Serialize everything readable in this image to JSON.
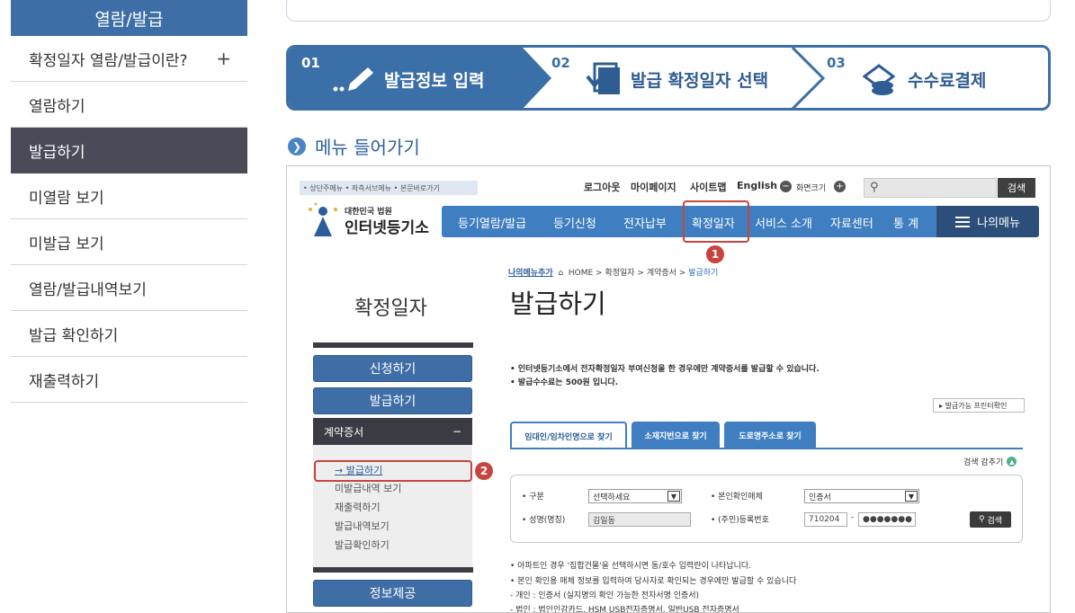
{
  "left_nav": {
    "title": "열람/발급",
    "items": [
      {
        "label": "확정일자 열람/발급이란?",
        "toggle": "+"
      },
      {
        "label": "열람하기"
      },
      {
        "label": "발급하기"
      },
      {
        "label": "미열람 보기"
      },
      {
        "label": "미발급 보기"
      },
      {
        "label": "열람/발급내역보기"
      },
      {
        "label": "발급 확인하기"
      },
      {
        "label": "재출력하기"
      }
    ]
  },
  "steps": [
    {
      "num": "01",
      "label": "발급정보 입력",
      "icon": "pencil-icon"
    },
    {
      "num": "02",
      "label": "발급 확정일자 선택",
      "icon": "document-check-icon"
    },
    {
      "num": "03",
      "label": "수수료결제",
      "icon": "coins-icon"
    }
  ],
  "section_title": "메뉴 들어가기",
  "screenshot": {
    "skip_links": "• 상단주메뉴 • 좌측서브메뉴 • 본문바로가기",
    "util": {
      "logout": "로그아웃",
      "mypage": "마이페이지",
      "sitemap": "사이트맵",
      "english": "English",
      "zoom": "화면크기",
      "minus": "−",
      "plus": "+"
    },
    "search_button": "검색",
    "logo": {
      "sub": "대한민국 법원",
      "main": "인터넷등기소"
    },
    "gnb": [
      "등기열람/발급",
      "등기신청",
      "전자납부",
      "확정일자",
      "서비스 소개",
      "자료센터",
      "통 계"
    ],
    "my_menu": "나의메뉴",
    "badge1": "1",
    "badge2": "2",
    "breadcrumb": {
      "my": "나의메뉴추가",
      "path": "HOME > 확정일자 > 계약증서 > ",
      "current": "발급하기"
    },
    "side_title": "확정일자",
    "page_title": "발급하기",
    "side_menu": {
      "apply": "신청하기",
      "issue": "발급하기",
      "group": "계약증서",
      "group_toggle": "−",
      "subs": [
        "→ 발급하기",
        "미발급내역 보기",
        "재출력하기",
        "발급내역보기",
        "발급확인하기"
      ],
      "info": "정보제공"
    },
    "bullets": [
      "• 인터넷등기소에서 전자확정일자 부여신청을 한 경우에만 계약증서를 발급할 수 있습니다.",
      "• 발급수수료는 500원 입니다."
    ],
    "printer_button": "발급가능 프린터확인",
    "tabs": [
      "임대인/임차인명으로 찾기",
      "소재지번으로 찾기",
      "도로명주소로 찾기"
    ],
    "fold": "검색 감추기",
    "form": {
      "type_label": "• 구분",
      "type_value": "선택하세요",
      "auth_label": "• 본인확인매체",
      "auth_value": "인증서",
      "name_label": "• 성명(명칭)",
      "name_value": "김일동",
      "rrn_label": "• (주민)등록번호",
      "rrn_front": "710204",
      "rrn_dash": "-",
      "rrn_back": "●●●●●●●",
      "search": "검색"
    },
    "notes": [
      "• 아파트인 경우 '집합건물'을 선택하시면 동/호수 입력란이 나타납니다.",
      "• 본인 확인용 매체 정보를 입력하여 당사자로 확인되는 경우에만 발급할 수 있습니다",
      "  - 개인 : 인증서 (실지명의 확인 가능한 전자서명 인증서)",
      "  - 법인 : 법인인감카드, HSM USB전자증명서, 일반USB 전자증명서"
    ]
  }
}
